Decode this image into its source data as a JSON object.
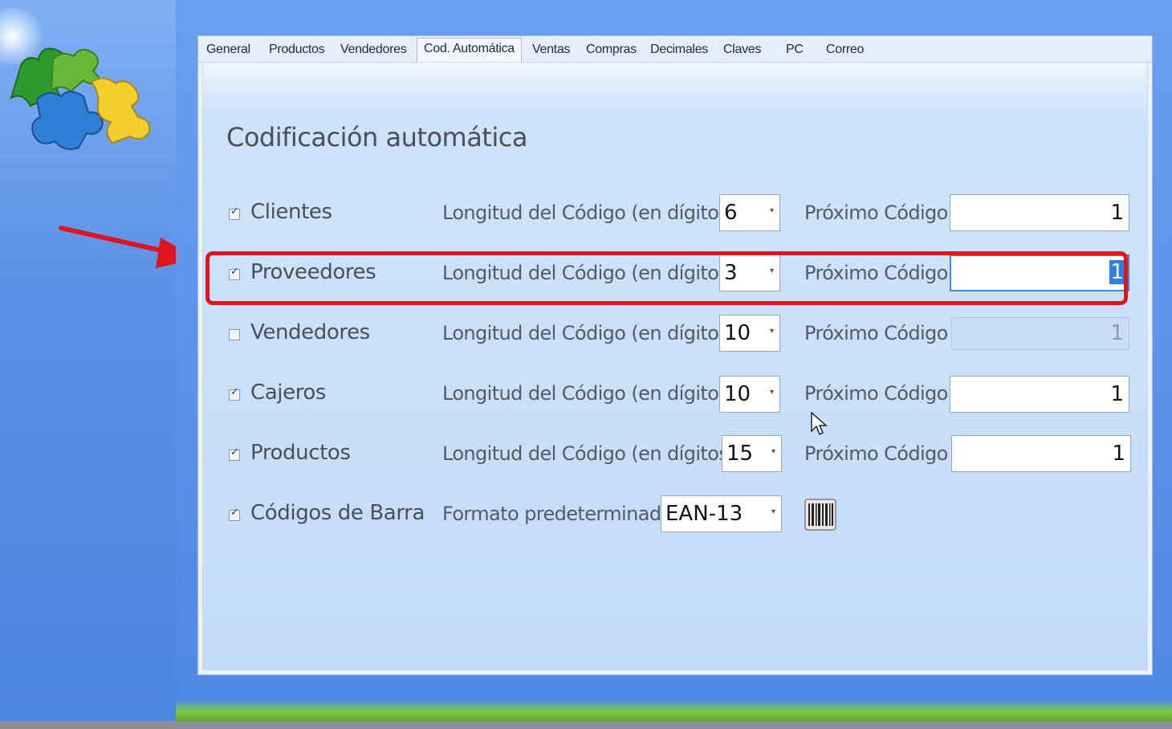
{
  "tabs": [
    {
      "label": "General"
    },
    {
      "label": "Productos"
    },
    {
      "label": "Vendedores"
    },
    {
      "label": "Cod. Automática",
      "active": true
    },
    {
      "label": "Ventas"
    },
    {
      "label": "Compras"
    },
    {
      "label": "Decimales"
    },
    {
      "label": "Claves"
    },
    {
      "label": "PC"
    },
    {
      "label": "Correo"
    }
  ],
  "title": "Codificación automática",
  "rows": [
    {
      "label": "Clientes",
      "checked": true,
      "length_label": "Longitud del Código (en dígitos)",
      "length": "6",
      "next_label": "Próximo Código",
      "next": "1",
      "enabled": true
    },
    {
      "label": "Proveedores",
      "checked": true,
      "length_label": "Longitud del Código (en dígitos)",
      "length": "3",
      "next_label": "Próximo Código",
      "next": "1",
      "enabled": true,
      "focused": true
    },
    {
      "label": "Vendedores",
      "checked": false,
      "length_label": "Longitud del Código (en dígitos)",
      "length": "10",
      "next_label": "Próximo Código",
      "next": "1",
      "enabled": false
    },
    {
      "label": "Cajeros",
      "checked": true,
      "length_label": "Longitud del Código (en dígitos)",
      "length": "10",
      "next_label": "Próximo Código",
      "next": "1",
      "enabled": true
    },
    {
      "label": "Productos",
      "checked": true,
      "length_label": "Longitud del Código (en dígitos)",
      "length": "15",
      "next_label": "Próximo Código",
      "next": "1",
      "enabled": true
    }
  ],
  "barcode": {
    "label": "Códigos de Barra",
    "checked": true,
    "format_label": "Formato predeterminado",
    "format": "EAN-13"
  },
  "icons": {
    "logo": "puzzle-logo-icon",
    "barcode": "barcode-icon",
    "arrow": "red-arrow-annotation",
    "cursor": "mouse-pointer-icon",
    "check": "✓",
    "dropdown": "▾"
  },
  "colors": {
    "highlight": "#e0141a",
    "focus": "#3a8ce8"
  }
}
